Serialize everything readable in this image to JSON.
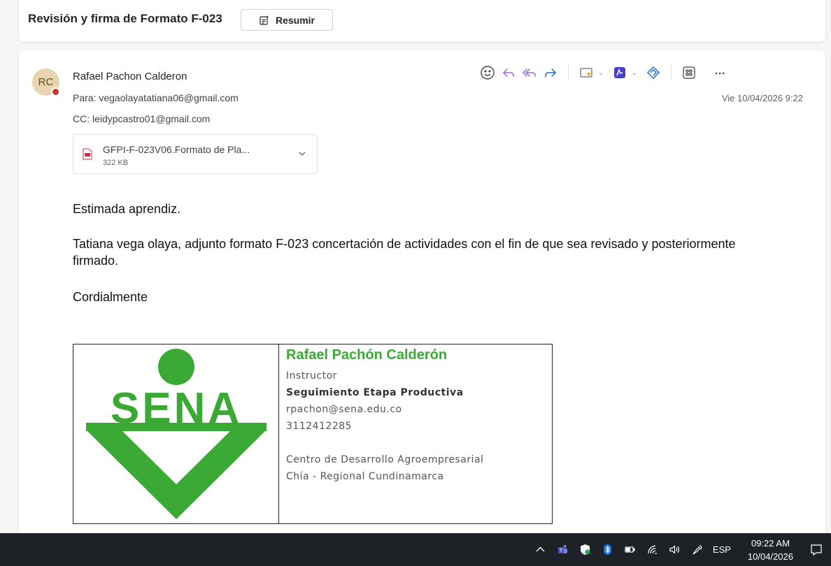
{
  "subject": {
    "title": "Revisión y firma de Formato F-023",
    "summarize_label": "Resumir"
  },
  "message": {
    "avatar_initials": "RC",
    "sender": "Rafael Pachon Calderon",
    "to": "Para:  vegaolayatatiana06@gmail.com",
    "cc": "CC:  leidypcastro01@gmail.com",
    "date": "Vie 10/04/2026 9:22",
    "attachment": {
      "name": "GFPI-F-023V06.Formato de Pla...",
      "size": "322 KB"
    },
    "body": {
      "greeting": "Estimada aprendiz.",
      "paragraph": "Tatiana vega olaya, adjunto formato F-023 concertación de actividades con el fin de que sea revisado y posteriormente firmado.",
      "closing": "Cordialmente"
    },
    "signature": {
      "logo_text": "SENA",
      "name": "Rafael Pachón Calderón",
      "role": "Instructor",
      "area": "Seguimiento Etapa Productiva",
      "email": "rpachon@sena.edu.co",
      "phone": "3112412285",
      "center": "Centro de Desarrollo Agroempresarial",
      "regional": "Chía - Regional Cundinamarca"
    }
  },
  "colors": {
    "sena_green": "#3aaa35",
    "reply_purple": "#9c6ad8",
    "forward_blue": "#1f6fd1",
    "taskbar": "#1e2125"
  },
  "taskbar": {
    "lang": "ESP",
    "time": "09:22 AM",
    "date": "10/04/2026"
  }
}
